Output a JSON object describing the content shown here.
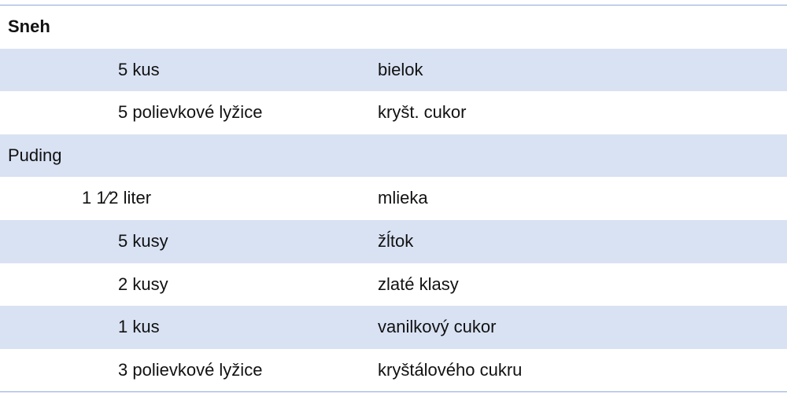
{
  "sections": [
    {
      "title": "Sneh",
      "items": [
        {
          "qty": "5 kus",
          "ingredient": "bielok"
        },
        {
          "qty": "5 polievkové lyžice",
          "ingredient": "kryšt. cukor"
        }
      ]
    },
    {
      "title": "Puding",
      "items": [
        {
          "qty": "1 1⁄2 liter",
          "ingredient": "mlieka"
        },
        {
          "qty": "5 kusy",
          "ingredient": "žĺtok"
        },
        {
          "qty": "2 kusy",
          "ingredient": "zlaté klasy"
        },
        {
          "qty": "1 kus",
          "ingredient": "vanilkový cukor"
        },
        {
          "qty": "3 polievkové lyžice",
          "ingredient": "kryštálového cukru"
        }
      ]
    }
  ]
}
